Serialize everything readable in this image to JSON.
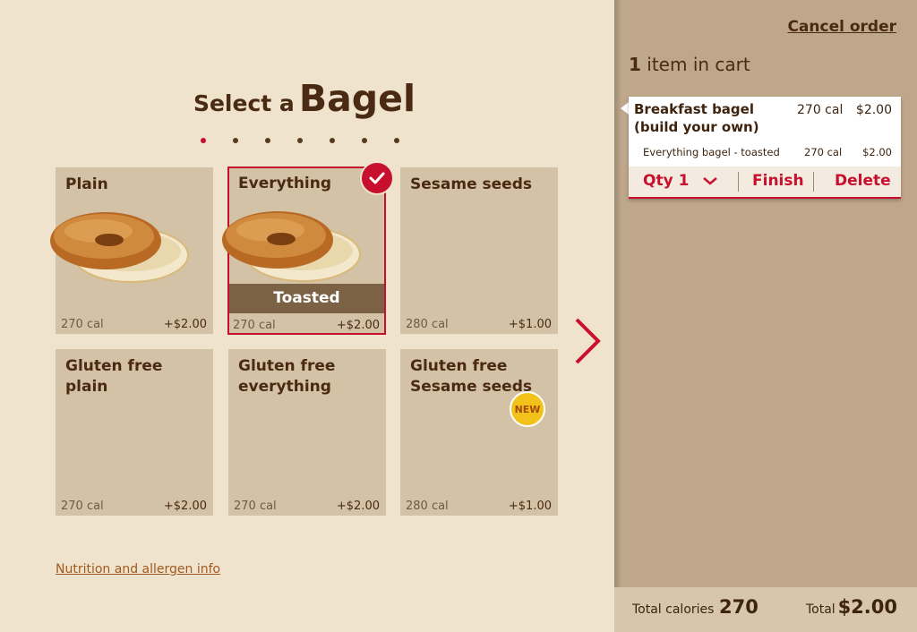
{
  "header": {
    "title_prefix": "Select a",
    "title_main": "Bagel"
  },
  "progress": {
    "step_count": 7,
    "active_step": 1
  },
  "options": [
    {
      "name": "Plain",
      "cal": "270 cal",
      "price": "+$2.00",
      "has_image": true,
      "selected": false
    },
    {
      "name": "Everything",
      "cal": "270 cal",
      "price": "+$2.00",
      "has_image": true,
      "selected": true,
      "overlay_label": "Toasted"
    },
    {
      "name": "Sesame seeds",
      "cal": "280 cal",
      "price": "+$1.00",
      "has_image": false,
      "selected": false
    },
    {
      "name": "Gluten free\nplain",
      "cal": "270 cal",
      "price": "+$2.00",
      "has_image": false,
      "selected": false
    },
    {
      "name": "Gluten free\neverything",
      "cal": "270 cal",
      "price": "+$2.00",
      "has_image": false,
      "selected": false
    },
    {
      "name": "Gluten free\nSesame seeds",
      "cal": "280 cal",
      "price": "+$1.00",
      "has_image": false,
      "selected": false,
      "badge": "NEW"
    }
  ],
  "nav": {
    "next_icon": "chevron-right-icon"
  },
  "footer_link": "Nutrition and allergen info",
  "cart": {
    "cancel_label": "Cancel order",
    "count": "1",
    "count_label": "item in cart",
    "item": {
      "name": "Breakfast bagel\n(build your own)",
      "cal": "270 cal",
      "price": "$2.00",
      "sub_name": "Everything bagel - toasted",
      "sub_cal": "270 cal",
      "sub_price": "$2.00"
    },
    "actions": {
      "qty_label": "Qty",
      "qty_value": "1",
      "finish": "Finish",
      "delete": "Delete"
    },
    "totals": {
      "calories_label": "Total calories",
      "calories_value": "270",
      "total_label": "Total",
      "total_value": "$2.00"
    }
  },
  "colors": {
    "accent": "#c8102e",
    "background": "#efe3cd",
    "card": "#d4c2a6",
    "sidebar": "#bfa78b",
    "badge": "#f2c21a"
  }
}
